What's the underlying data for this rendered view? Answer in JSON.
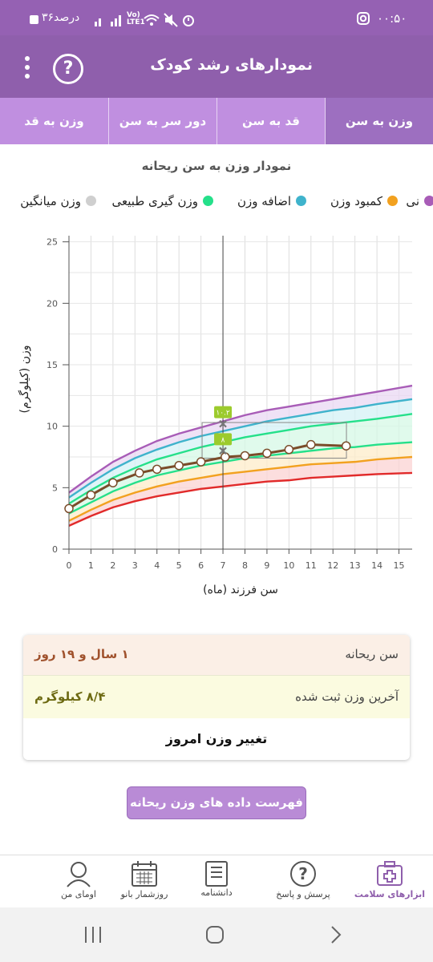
{
  "status": {
    "time": "۰۰:۵۰",
    "battery": "۳۶درصد",
    "network": "Vo) LTE1"
  },
  "app_bar": {
    "title": "نمودارهای رشد کودک",
    "help_label": "?"
  },
  "tabs": [
    {
      "label": "وزن به سن",
      "active": true
    },
    {
      "label": "قد به سن",
      "active": false
    },
    {
      "label": "دور سر به سن",
      "active": false
    },
    {
      "label": "وزن به قد",
      "active": false
    }
  ],
  "chart": {
    "title": "نمودار وزن به سن ریحانه",
    "legend": [
      {
        "label": "نی",
        "color": "#a85cb7"
      },
      {
        "label": "کمبود وزن",
        "color": "#f2a11f"
      },
      {
        "label": "اضافه وزن",
        "color": "#3fb3cc"
      },
      {
        "label": "وزن گیری طبیعی",
        "color": "#25e08a"
      },
      {
        "label": "وزن میانگین",
        "color": "#cfcfcf"
      }
    ],
    "ylabel": "وزن (کیلوگرم)",
    "xlabel": "سن فرزند (ماه)",
    "marker_labels": [
      "۱۰.۲",
      "۸"
    ]
  },
  "chart_data": {
    "type": "line",
    "x_ticks": [
      0,
      1,
      2,
      3,
      4,
      5,
      6,
      7,
      8,
      9,
      10,
      11,
      12,
      13,
      14,
      15
    ],
    "y_ticks": [
      0,
      5,
      10,
      15,
      20,
      25
    ],
    "xlim": [
      0,
      15.6
    ],
    "ylim": [
      0,
      25.5
    ],
    "curves": [
      {
        "color": "#a85cb7",
        "x": [
          0,
          1,
          2,
          3,
          4,
          5,
          6,
          7,
          8,
          9,
          10,
          11,
          12,
          13,
          14,
          15.6
        ],
        "y": [
          4.6,
          5.9,
          7.1,
          8.0,
          8.8,
          9.4,
          9.9,
          10.4,
          10.9,
          11.3,
          11.6,
          11.9,
          12.2,
          12.5,
          12.8,
          13.3
        ]
      },
      {
        "color": "#3fb3cc",
        "x": [
          0,
          1,
          2,
          3,
          4,
          5,
          6,
          7,
          8,
          9,
          10,
          11,
          12,
          13,
          14,
          15.6
        ],
        "y": [
          4.2,
          5.4,
          6.5,
          7.4,
          8.1,
          8.7,
          9.2,
          9.6,
          10.0,
          10.4,
          10.7,
          11.0,
          11.3,
          11.5,
          11.8,
          12.2
        ]
      },
      {
        "color": "#25e08a",
        "x": [
          0,
          1,
          2,
          3,
          4,
          5,
          6,
          7,
          8,
          9,
          10,
          11,
          12,
          13,
          14,
          15.6
        ],
        "y": [
          3.7,
          4.8,
          5.8,
          6.6,
          7.3,
          7.8,
          8.3,
          8.7,
          9.1,
          9.4,
          9.7,
          10.0,
          10.2,
          10.4,
          10.6,
          11.0
        ]
      },
      {
        "color": "#25e08a",
        "x": [
          0,
          1,
          2,
          3,
          4,
          5,
          6,
          7,
          8,
          9,
          10,
          11,
          12,
          13,
          14,
          15.6
        ],
        "y": [
          2.9,
          3.8,
          4.7,
          5.4,
          6.0,
          6.4,
          6.8,
          7.1,
          7.4,
          7.6,
          7.8,
          8.0,
          8.2,
          8.3,
          8.5,
          8.7
        ]
      },
      {
        "color": "#f2a11f",
        "x": [
          0,
          1,
          2,
          3,
          4,
          5,
          6,
          7,
          8,
          9,
          10,
          11,
          12,
          13,
          14,
          15.6
        ],
        "y": [
          2.3,
          3.2,
          4.0,
          4.6,
          5.1,
          5.5,
          5.8,
          6.1,
          6.3,
          6.5,
          6.7,
          6.9,
          7.0,
          7.1,
          7.3,
          7.5
        ]
      },
      {
        "color": "#e12a2a",
        "x": [
          0,
          1,
          2,
          3,
          4,
          5,
          6,
          7,
          8,
          9,
          10,
          11,
          12,
          13,
          14,
          15.6
        ],
        "y": [
          1.9,
          2.7,
          3.4,
          3.9,
          4.3,
          4.6,
          4.9,
          5.1,
          5.3,
          5.5,
          5.6,
          5.8,
          5.9,
          6.0,
          6.1,
          6.2
        ]
      }
    ],
    "child_weights": {
      "x": [
        0,
        1,
        2,
        3.2,
        4,
        5,
        6,
        7.1,
        8,
        9,
        10,
        11,
        12.6
      ],
      "y": [
        3.3,
        4.4,
        5.4,
        6.2,
        6.5,
        6.8,
        7.1,
        7.5,
        7.6,
        7.8,
        8.1,
        8.5,
        8.4
      ],
      "color": "#7a4c2a"
    },
    "markers": [
      {
        "x": 7,
        "y": 10.2,
        "label": "۱۰.۲"
      },
      {
        "x": 7,
        "y": 8.0,
        "label": "۸"
      }
    ]
  },
  "info": {
    "age_label": "سن ریحانه",
    "age_value": "۱ سال و ۱۹ روز",
    "weight_label": "آخرین وزن ثبت شده",
    "weight_value": "۸/۴ کیلوگرم",
    "change_label": "تغییر وزن امروز"
  },
  "list_button": "فهرست داده های وزن ریحانه",
  "bottom_nav": [
    {
      "label": "ابزارهای سلامت",
      "icon": "medical-kit-icon",
      "active": true
    },
    {
      "label": "پرسش و پاسخ",
      "icon": "question-icon",
      "active": false
    },
    {
      "label": "دانشنامه",
      "icon": "book-icon",
      "active": false
    },
    {
      "label": "روزشمار بانو",
      "icon": "calendar-icon",
      "active": false
    },
    {
      "label": "اومای من",
      "icon": "avatar-icon",
      "active": false
    }
  ]
}
